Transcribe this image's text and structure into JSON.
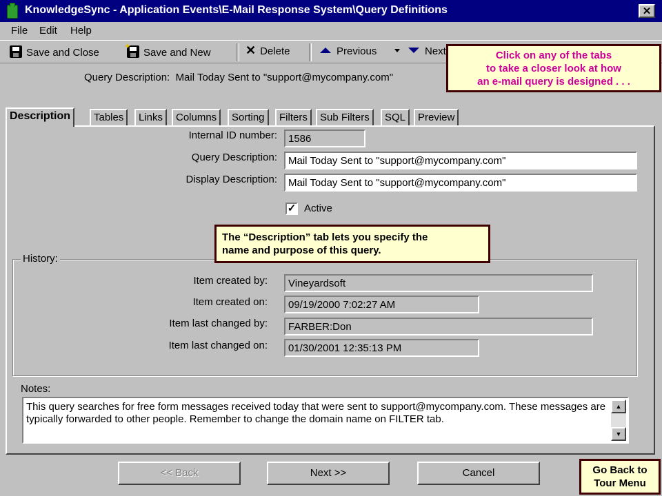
{
  "window": {
    "title": "KnowledgeSync - Application Events\\E-Mail Response System\\Query Definitions",
    "close_glyph": "✕"
  },
  "menu": {
    "file": "File",
    "edit": "Edit",
    "help": "Help"
  },
  "toolbar": {
    "save_close": "Save and Close",
    "save_new": "Save and New",
    "delete": "Delete",
    "previous": "Previous",
    "next": "Next"
  },
  "header": {
    "query_label": "Query Description:",
    "query_value": "Mail Today Sent to \"support@mycompany.com\""
  },
  "callout_tabs": {
    "line1": "Click on any of the tabs",
    "line2": "to take a closer look at how",
    "line3": "an e-mail query is designed . . ."
  },
  "tabs": [
    "Description",
    "Tables",
    "Links",
    "Columns",
    "Sorting",
    "Filters",
    "Sub Filters",
    "SQL",
    "Preview"
  ],
  "form": {
    "internal_id_label": "Internal ID number:",
    "internal_id": "1586",
    "query_desc_label": "Query Description:",
    "query_desc": "Mail Today Sent to \"support@mycompany.com\"",
    "display_desc_label": "Display Description:",
    "display_desc": "Mail Today Sent to \"support@mycompany.com\"",
    "active_label": "Active",
    "active_check": "✓"
  },
  "callout_desc": {
    "line1": "The “Description” tab lets you specify the",
    "line2": "name and purpose of this query."
  },
  "history": {
    "title": "History:",
    "created_by_label": "Item created by:",
    "created_by": "Vineyardsoft",
    "created_on_label": "Item created on:",
    "created_on": "09/19/2000 7:02:27 AM",
    "changed_by_label": "Item last changed by:",
    "changed_by": "FARBER:Don",
    "changed_on_label": "Item last changed on:",
    "changed_on": "01/30/2001 12:35:13 PM"
  },
  "notes": {
    "label": "Notes:",
    "text": "This query searches for free form messages received today that were sent to support@mycompany.com. These messages are typically forwarded to other people. Remember to change the domain name on FILTER tab."
  },
  "buttons": {
    "back": "<< Back",
    "next": "Next >>",
    "cancel": "Cancel"
  },
  "tour": {
    "line1": "Go Back to",
    "line2": "Tour Menu"
  }
}
